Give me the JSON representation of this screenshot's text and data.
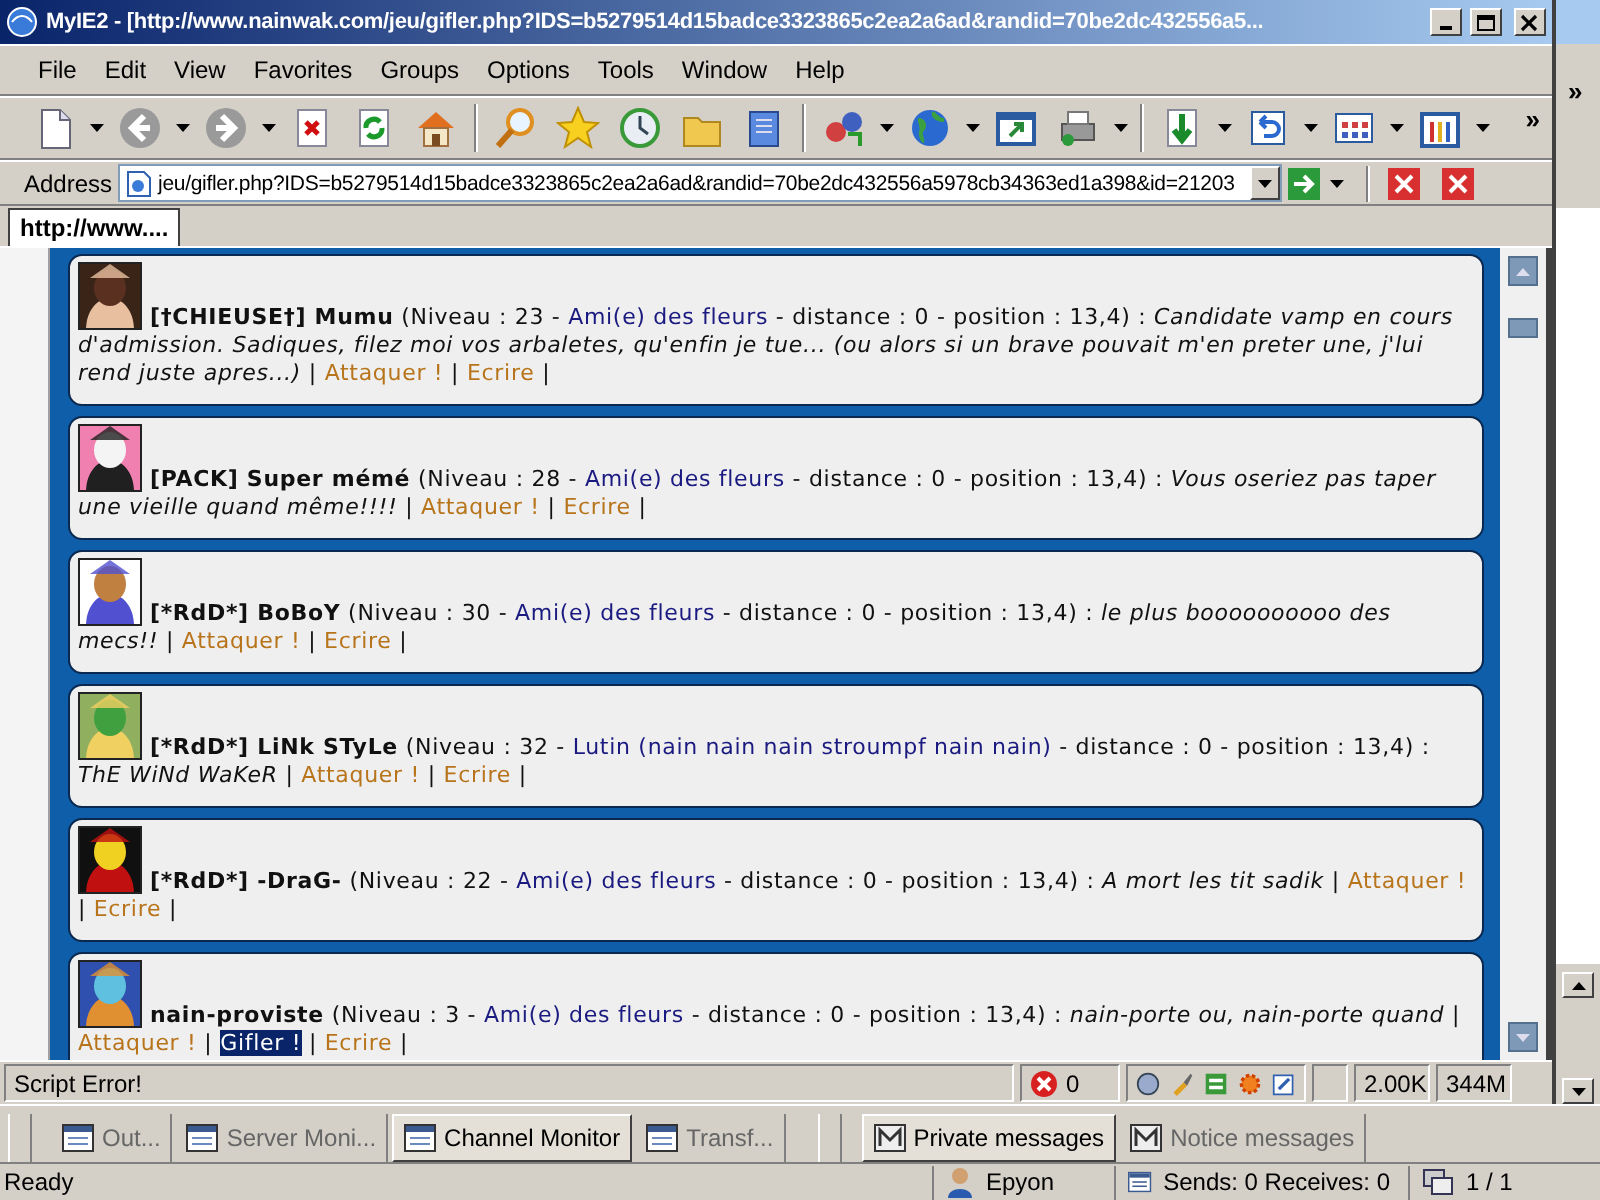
{
  "window": {
    "title": "MyIE2 - [http://www.nainwak.com/jeu/gifler.php?IDS=b5279514d15badce3323865c2ea2a6ad&randid=70be2dc432556a5..."
  },
  "menu": [
    "File",
    "Edit",
    "View",
    "Favorites",
    "Groups",
    "Options",
    "Tools",
    "Window",
    "Help"
  ],
  "toolbar_overflow": "»",
  "side_overflow": "»",
  "address": {
    "label": "Address",
    "value": "jeu/gifler.php?IDS=b5279514d15badce3323865c2ea2a6ad&randid=70be2dc432556a5978cb34363ed1a398&id=21203"
  },
  "tabs": [
    {
      "label": "http://www....",
      "selected": true
    }
  ],
  "players": [
    {
      "name": "[†CHIEUSE†] Mumu",
      "level_text": "(Niveau : 23 -",
      "race": "Ami(e) des fleurs",
      "location_text": "- distance : 0 - position : 13,4) :",
      "message": "Candidate vamp en cours d'admission. Sadiques, filez moi vos arbaletes, qu'enfin je tue... (ou alors si un brave pouvait m'en preter une, j'lui rend juste apres...)",
      "tail": [
        {
          "kind": "separator",
          "text": "|"
        },
        {
          "kind": "link",
          "text": "Attaquer !",
          "highlighted": false
        },
        {
          "kind": "separator",
          "text": "|"
        },
        {
          "kind": "link",
          "text": "Ecrire",
          "highlighted": false
        },
        {
          "kind": "separator",
          "text": "|"
        }
      ]
    },
    {
      "name": "[PACK] Super mémé",
      "level_text": "(Niveau : 28 -",
      "race": "Ami(e) des fleurs",
      "location_text": "- distance : 0 - position : 13,4) :",
      "message": "Vous oseriez pas taper une vieille quand même!!!!",
      "tail": [
        {
          "kind": "separator",
          "text": "|"
        },
        {
          "kind": "link",
          "text": "Attaquer !",
          "highlighted": false
        },
        {
          "kind": "separator",
          "text": "|"
        },
        {
          "kind": "link",
          "text": "Ecrire",
          "highlighted": false
        },
        {
          "kind": "separator",
          "text": "|"
        }
      ]
    },
    {
      "name": "[*RdD*] BoBoY",
      "level_text": "(Niveau : 30 -",
      "race": "Ami(e) des fleurs",
      "location_text": "- distance : 0 - position : 13,4) :",
      "message": "le plus boooooooooo des mecs!!",
      "tail": [
        {
          "kind": "separator",
          "text": "|"
        },
        {
          "kind": "link",
          "text": "Attaquer !",
          "highlighted": false
        },
        {
          "kind": "separator",
          "text": "|"
        },
        {
          "kind": "link",
          "text": "Ecrire",
          "highlighted": false
        },
        {
          "kind": "separator",
          "text": "|"
        }
      ]
    },
    {
      "name": "[*RdD*] LiNk STyLe",
      "level_text": "(Niveau : 32 -",
      "race": "Lutin (nain nain nain stroumpf nain nain)",
      "location_text": "- distance : 0 - position : 13,4) :",
      "message": "ThE WiNd WaKeR",
      "tail": [
        {
          "kind": "separator",
          "text": "|"
        },
        {
          "kind": "link",
          "text": "Attaquer !",
          "highlighted": false
        },
        {
          "kind": "separator",
          "text": "|"
        },
        {
          "kind": "link",
          "text": "Ecrire",
          "highlighted": false
        },
        {
          "kind": "separator",
          "text": "|"
        }
      ]
    },
    {
      "name": "[*RdD*] -DraG-",
      "level_text": "(Niveau : 22 -",
      "race": "Ami(e) des fleurs",
      "location_text": "- distance : 0 - position : 13,4) :",
      "message": "A mort les tit sadik",
      "tail": [
        {
          "kind": "separator",
          "text": "|"
        },
        {
          "kind": "link",
          "text": "Attaquer !",
          "highlighted": false
        },
        {
          "kind": "separator",
          "text": "|"
        },
        {
          "kind": "link",
          "text": "Ecrire",
          "highlighted": false
        },
        {
          "kind": "separator",
          "text": "|"
        }
      ]
    },
    {
      "name": "nain-proviste",
      "level_text": "(Niveau : 3 -",
      "race": "Ami(e) des fleurs",
      "location_text": "- distance : 0 - position : 13,4) :",
      "message": "nain-porte ou, nain-porte quand",
      "tail": [
        {
          "kind": "separator",
          "text": "|"
        },
        {
          "kind": "link",
          "text": "Attaquer !",
          "highlighted": false
        },
        {
          "kind": "separator",
          "text": "|"
        },
        {
          "kind": "link",
          "text": "Gifler !",
          "highlighted": true
        },
        {
          "kind": "separator",
          "text": "|"
        },
        {
          "kind": "link",
          "text": "Ecrire",
          "highlighted": false
        },
        {
          "kind": "separator",
          "text": "|"
        }
      ]
    }
  ],
  "status_bar": {
    "message": "Script Error!",
    "errors": "0",
    "size": "2.00K",
    "memory": "344M"
  },
  "dock_tabs": [
    {
      "label": "Out...",
      "selected": false
    },
    {
      "label": "Server Moni...",
      "selected": false
    },
    {
      "label": "Channel Monitor",
      "selected": true
    },
    {
      "label": "Transf...",
      "selected": false
    }
  ],
  "message_tabs": [
    {
      "label": "Private messages",
      "selected": true
    },
    {
      "label": "Notice messages",
      "selected": false
    }
  ],
  "bottom_bar": {
    "status": "Ready",
    "user": "Epyon",
    "traffic": "Sends: 0 Receives: 0",
    "pages": "1 / 1"
  }
}
